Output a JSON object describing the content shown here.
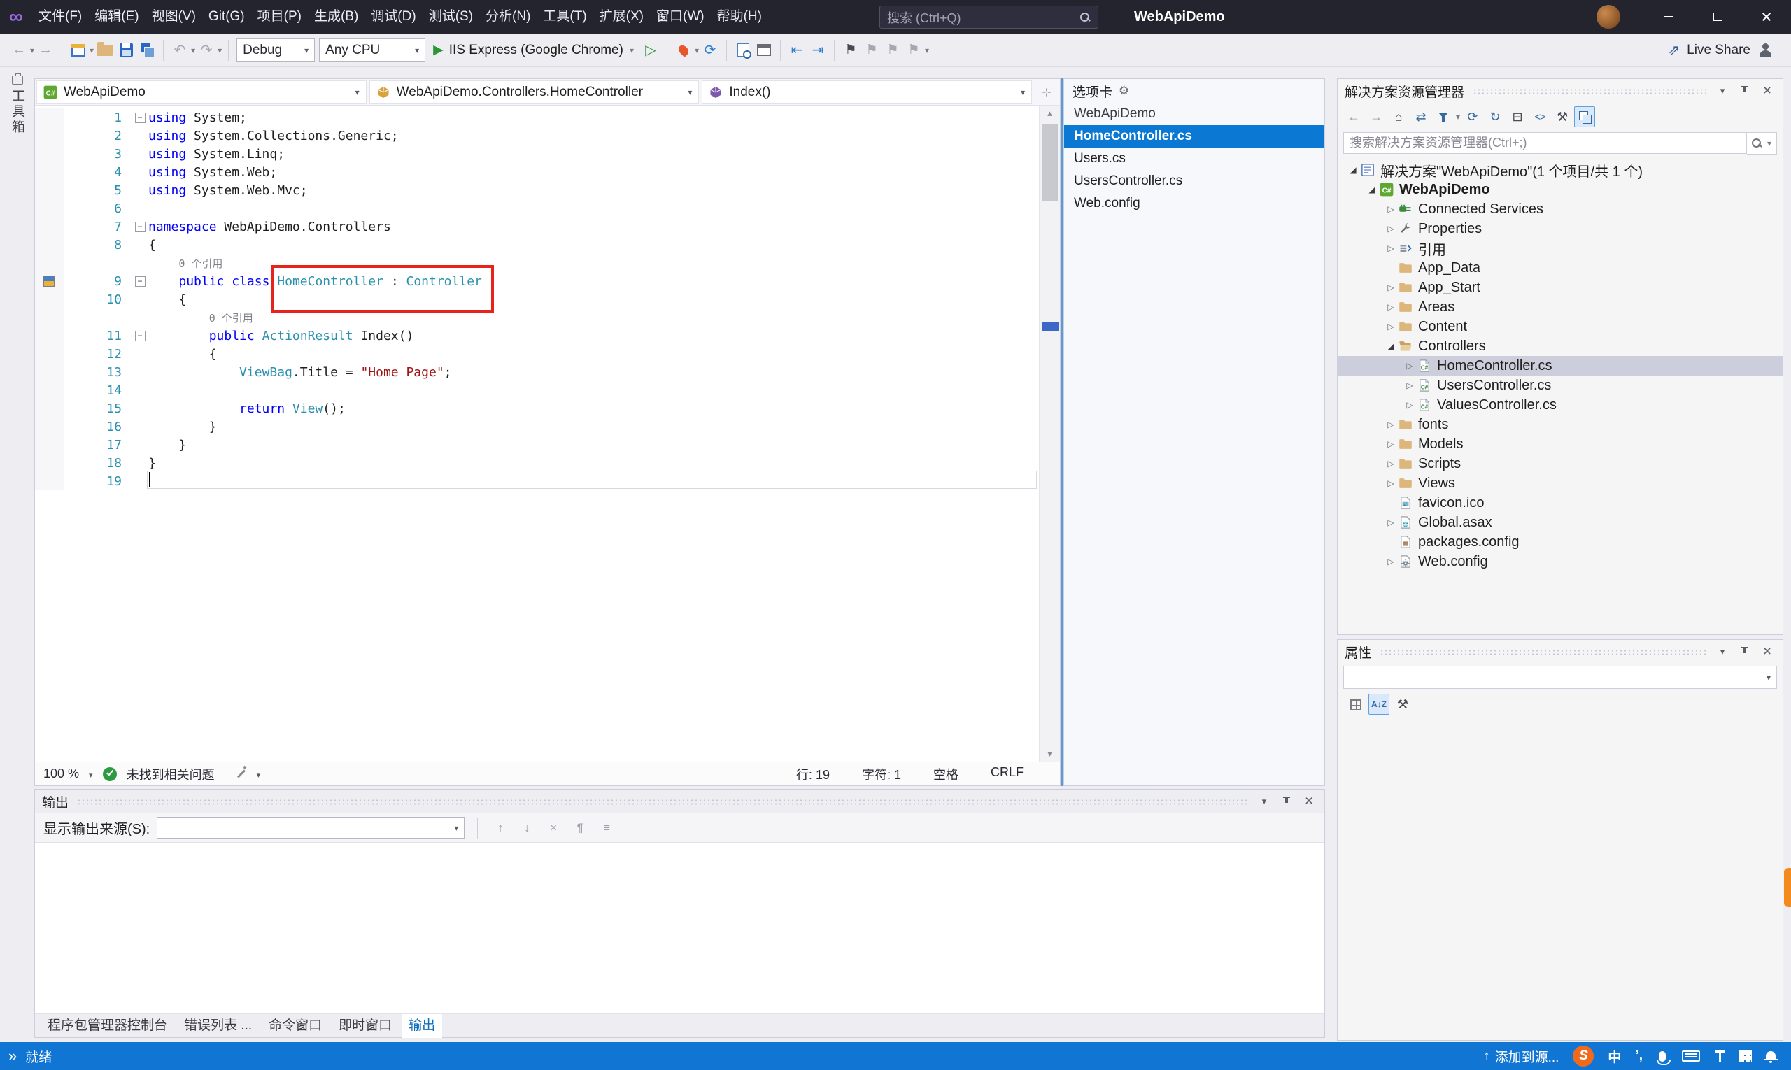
{
  "titlebar": {
    "menus": [
      "文件(F)",
      "编辑(E)",
      "视图(V)",
      "Git(G)",
      "项目(P)",
      "生成(B)",
      "调试(D)",
      "测试(S)",
      "分析(N)",
      "工具(T)",
      "扩展(X)",
      "窗口(W)",
      "帮助(H)"
    ],
    "search_placeholder": "搜索 (Ctrl+Q)",
    "app_title": "WebApiDemo"
  },
  "toolbar": {
    "debug_config": "Debug",
    "platform": "Any CPU",
    "run_target": "IIS Express (Google Chrome)",
    "live_share": "Live Share"
  },
  "left_strip": {
    "toolbox_label": "工具箱"
  },
  "editor": {
    "nav": {
      "project": "WebApiDemo",
      "type": "WebApiDemo.Controllers.HomeController",
      "member": "Index()"
    },
    "lines": [
      {
        "n": 1,
        "fold": true,
        "t": [
          [
            "using",
            "k"
          ],
          [
            " System;",
            "p"
          ]
        ]
      },
      {
        "n": 2,
        "t": [
          [
            "using",
            "k"
          ],
          [
            " System.Collections.Generic;",
            "p"
          ]
        ]
      },
      {
        "n": 3,
        "t": [
          [
            "using",
            "k"
          ],
          [
            " System.Linq;",
            "p"
          ]
        ]
      },
      {
        "n": 4,
        "t": [
          [
            "using",
            "k"
          ],
          [
            " System.Web;",
            "p"
          ]
        ]
      },
      {
        "n": 5,
        "t": [
          [
            "using",
            "k"
          ],
          [
            " System.Web.Mvc;",
            "p"
          ]
        ]
      },
      {
        "n": 6,
        "t": []
      },
      {
        "n": 7,
        "fold": true,
        "t": [
          [
            "namespace",
            "k"
          ],
          [
            " WebApiDemo.Controllers",
            "p"
          ]
        ]
      },
      {
        "n": 8,
        "t": [
          [
            "{",
            "p"
          ]
        ]
      },
      {
        "lens": "0 个引用",
        "pad": 4
      },
      {
        "n": 9,
        "fold": true,
        "glyph": true,
        "t": [
          [
            "    ",
            "p"
          ],
          [
            "public",
            "k"
          ],
          [
            " ",
            "p"
          ],
          [
            "class",
            "k"
          ],
          [
            " ",
            "p"
          ],
          [
            "HomeController",
            "t"
          ],
          [
            " : ",
            "p"
          ],
          [
            "Controller",
            "t"
          ]
        ]
      },
      {
        "n": 10,
        "t": [
          [
            "    {",
            "p"
          ]
        ]
      },
      {
        "lens": "0 个引用",
        "pad": 8
      },
      {
        "n": 11,
        "fold": true,
        "t": [
          [
            "        ",
            "p"
          ],
          [
            "public",
            "k"
          ],
          [
            " ",
            "p"
          ],
          [
            "ActionResult",
            "t"
          ],
          [
            " Index()",
            "p"
          ]
        ]
      },
      {
        "n": 12,
        "t": [
          [
            "        {",
            "p"
          ]
        ]
      },
      {
        "n": 13,
        "t": [
          [
            "            ",
            "p"
          ],
          [
            "ViewBag",
            "t"
          ],
          [
            ".Title = ",
            "p"
          ],
          [
            "\"Home Page\"",
            "s"
          ],
          [
            ";",
            "p"
          ]
        ]
      },
      {
        "n": 14,
        "t": []
      },
      {
        "n": 15,
        "t": [
          [
            "            ",
            "p"
          ],
          [
            "return",
            "k"
          ],
          [
            " ",
            "p"
          ],
          [
            "View",
            "t"
          ],
          [
            "();",
            "p"
          ]
        ]
      },
      {
        "n": 16,
        "t": [
          [
            "        }",
            "p"
          ]
        ]
      },
      {
        "n": 17,
        "t": [
          [
            "    }",
            "p"
          ]
        ]
      },
      {
        "n": 18,
        "t": [
          [
            "}",
            "p"
          ]
        ]
      },
      {
        "n": 19,
        "t": []
      }
    ],
    "status": {
      "zoom": "100 %",
      "message": "未找到相关问题",
      "line": "行: 19",
      "column": "字符: 1",
      "spaces": "空格",
      "eol": "CRLF"
    }
  },
  "tabs_panel": {
    "title": "选项卡",
    "group": "WebApiDemo",
    "items": [
      {
        "label": "HomeController.cs",
        "selected": true
      },
      {
        "label": "Users.cs"
      },
      {
        "label": "UsersController.cs"
      },
      {
        "label": "Web.config"
      }
    ]
  },
  "solution_explorer": {
    "title": "解决方案资源管理器",
    "search_placeholder": "搜索解决方案资源管理器(Ctrl+;)",
    "tree": [
      {
        "indent": 0,
        "expander": "open",
        "icon": "solution",
        "label": "解决方案\"WebApiDemo\"(1 个项目/共 1 个)"
      },
      {
        "indent": 1,
        "expander": "open",
        "icon": "project",
        "label": "WebApiDemo",
        "bold": true
      },
      {
        "indent": 2,
        "expander": "closed",
        "icon": "connected",
        "label": "Connected Services"
      },
      {
        "indent": 2,
        "expander": "closed",
        "icon": "wrench",
        "label": "Properties"
      },
      {
        "indent": 2,
        "expander": "closed",
        "icon": "references",
        "label": "引用"
      },
      {
        "indent": 2,
        "expander": null,
        "icon": "folder",
        "label": "App_Data"
      },
      {
        "indent": 2,
        "expander": "closed",
        "icon": "folder",
        "label": "App_Start"
      },
      {
        "indent": 2,
        "expander": "closed",
        "icon": "folder",
        "label": "Areas"
      },
      {
        "indent": 2,
        "expander": "closed",
        "icon": "folder",
        "label": "Content"
      },
      {
        "indent": 2,
        "expander": "open",
        "icon": "folderOpen",
        "label": "Controllers"
      },
      {
        "indent": 3,
        "expander": "closed",
        "icon": "csfile",
        "label": "HomeController.cs",
        "selected": true
      },
      {
        "indent": 3,
        "expander": "closed",
        "icon": "csfile",
        "label": "UsersController.cs"
      },
      {
        "indent": 3,
        "expander": "closed",
        "icon": "csfile",
        "label": "ValuesController.cs"
      },
      {
        "indent": 2,
        "expander": "closed",
        "icon": "folder",
        "label": "fonts"
      },
      {
        "indent": 2,
        "expander": "closed",
        "icon": "folder",
        "label": "Models"
      },
      {
        "indent": 2,
        "expander": "closed",
        "icon": "folder",
        "label": "Scripts"
      },
      {
        "indent": 2,
        "expander": "closed",
        "icon": "folder",
        "label": "Views"
      },
      {
        "indent": 2,
        "expander": null,
        "icon": "image",
        "label": "favicon.ico"
      },
      {
        "indent": 2,
        "expander": "closed",
        "icon": "globe",
        "label": "Global.asax"
      },
      {
        "indent": 2,
        "expander": null,
        "icon": "package",
        "label": "packages.config"
      },
      {
        "indent": 2,
        "expander": "closed",
        "icon": "config",
        "label": "Web.config"
      }
    ]
  },
  "properties_panel": {
    "title": "属性"
  },
  "output": {
    "title": "输出",
    "source_label": "显示输出来源(S):",
    "tabs": [
      {
        "label": "程序包管理器控制台"
      },
      {
        "label": "错误列表 ..."
      },
      {
        "label": "命令窗口"
      },
      {
        "label": "即时窗口"
      },
      {
        "label": "输出",
        "active": true
      }
    ]
  },
  "statusbar": {
    "ready": "就绪",
    "add_to_source": "添加到源...",
    "ime_lang": "中",
    "ime_punct": "’,",
    "ime_brand": "S"
  },
  "icons": {
    "search": "magnifier",
    "caret_down": "▾",
    "close": "×",
    "minimize": "bar",
    "maximize": "box",
    "play": "▶",
    "play_outline": "▷",
    "back": "←",
    "forward": "→",
    "undo": "↶",
    "redo": "↷",
    "bookmark": "⚑",
    "home": "⌂",
    "refresh": "⟳",
    "gear": "⚙",
    "pin": "thumbtack",
    "bell": "bell"
  }
}
